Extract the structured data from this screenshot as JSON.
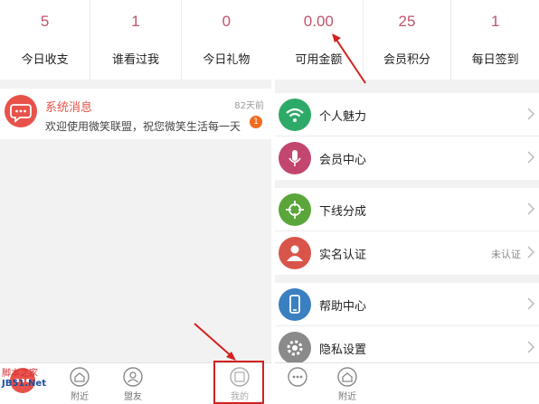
{
  "left": {
    "stats": [
      {
        "value": "5",
        "label": "今日收支"
      },
      {
        "value": "1",
        "label": "谁看过我"
      },
      {
        "value": "0",
        "label": "今日礼物"
      }
    ],
    "message": {
      "title": "系统消息",
      "time": "82天前",
      "text": "欢迎使用微笑联盟，祝您微笑生活每一天",
      "badge": "1",
      "icon": "chat-bubble-icon"
    },
    "tabs": [
      {
        "label": "附近",
        "icon": "house-icon"
      },
      {
        "label": "盟友",
        "icon": "person-icon"
      },
      {
        "label": "我的",
        "icon": "profile-icon"
      }
    ],
    "watermark": {
      "line1": "脚本之家",
      "line2": "JB51.Net"
    }
  },
  "right": {
    "stats": [
      {
        "value": "0.00",
        "label": "可用金额"
      },
      {
        "value": "25",
        "label": "会员积分"
      },
      {
        "value": "1",
        "label": "每日签到"
      }
    ],
    "menu_groups": [
      [
        {
          "label": "个人魅力",
          "icon": "wifi-icon",
          "color": "#2eaa68"
        },
        {
          "label": "会员中心",
          "icon": "microphone-icon",
          "color": "#c2466e"
        }
      ],
      [
        {
          "label": "下线分成",
          "icon": "crosshair-icon",
          "color": "#5aa63a"
        },
        {
          "label": "实名认证",
          "icon": "user-silhouette-icon",
          "color": "#d9554a",
          "status": "未认证"
        }
      ],
      [
        {
          "label": "帮助中心",
          "icon": "phone-icon",
          "color": "#3a7fc0"
        },
        {
          "label": "隐私设置",
          "icon": "gear-icon",
          "color": "#8a8a8a"
        }
      ]
    ],
    "tabs": [
      {
        "label": "",
        "icon": "circles-icon"
      },
      {
        "label": "附近",
        "icon": "house-icon"
      }
    ]
  },
  "colors": {
    "stat_number": "#c0546a",
    "message_title": "#e8524a",
    "badge": "#f26b1d",
    "annotation": "#d42020"
  }
}
